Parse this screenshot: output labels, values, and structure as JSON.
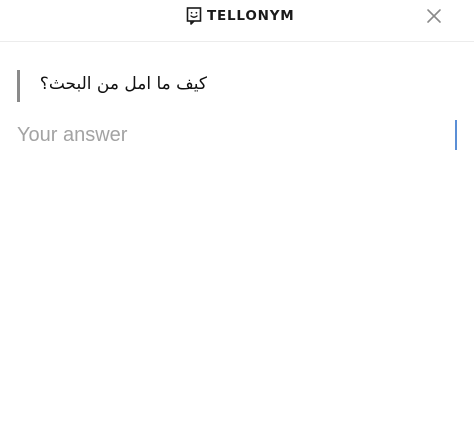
{
  "header": {
    "app_name": "TELLONYM",
    "logo_icon": "tellonym-face-icon",
    "close_icon": "close-icon"
  },
  "question": {
    "text": "كيف ما امل من البحث؟"
  },
  "answer": {
    "value": "",
    "placeholder": "Your answer"
  },
  "colors": {
    "text": "#111111",
    "placeholder": "#a3a3a3",
    "quote_bar": "#8a8a8a",
    "caret": "#5b8fd6",
    "divider": "#ececec"
  }
}
